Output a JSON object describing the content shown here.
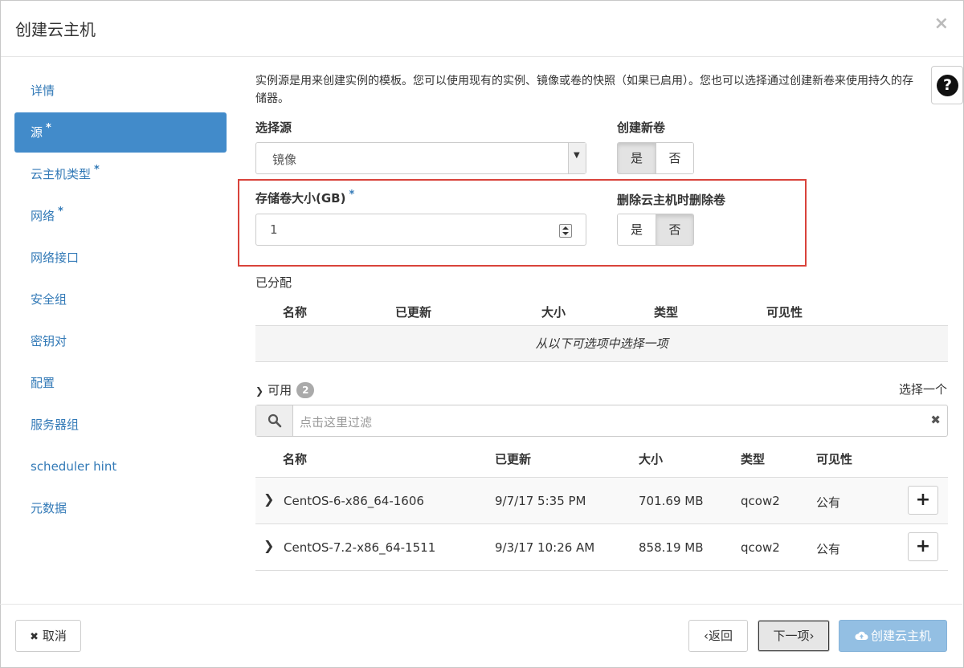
{
  "dialog": {
    "title": "创建云主机",
    "close_glyph": "×"
  },
  "nav": {
    "items": [
      {
        "label": "详情",
        "required": ""
      },
      {
        "label": "源",
        "required": "*"
      },
      {
        "label": "云主机类型",
        "required": "*"
      },
      {
        "label": "网络",
        "required": "*"
      },
      {
        "label": "网络接口",
        "required": ""
      },
      {
        "label": "安全组",
        "required": ""
      },
      {
        "label": "密钥对",
        "required": ""
      },
      {
        "label": "配置",
        "required": ""
      },
      {
        "label": "服务器组",
        "required": ""
      },
      {
        "label": "scheduler hint",
        "required": ""
      },
      {
        "label": "元数据",
        "required": ""
      }
    ],
    "active_index": 1
  },
  "source": {
    "intro": "实例源是用来创建实例的模板。您可以使用现有的实例、镜像或卷的快照（如果已启用）。您也可以选择通过创建新卷来使用持久的存储器。",
    "help_icon": "?",
    "select_source_label": "选择源",
    "select_source_value": "镜像",
    "create_volume_label": "创建新卷",
    "create_volume_yes": "是",
    "create_volume_no": "否",
    "create_volume_selected": "yes",
    "volume_size_label": "存储卷大小(GB)",
    "volume_size_required": "*",
    "volume_size_value": "1",
    "delete_on_terminate_label": "删除云主机时删除卷",
    "delete_yes": "是",
    "delete_no": "否",
    "delete_selected": "no"
  },
  "allocated": {
    "label": "已分配",
    "columns": [
      "名称",
      "已更新",
      "大小",
      "类型",
      "可见性"
    ],
    "empty_message": "从以下可选项中选择一项"
  },
  "available": {
    "label": "可用",
    "count": "2",
    "select_hint": "选择一个",
    "filter_placeholder": "点击这里过滤",
    "columns": [
      "名称",
      "已更新",
      "大小",
      "类型",
      "可见性"
    ],
    "rows": [
      {
        "name": "CentOS-6-x86_64-1606",
        "updated": "9/7/17 5:35 PM",
        "size": "701.69 MB",
        "type": "qcow2",
        "visibility": "公有"
      },
      {
        "name": "CentOS-7.2-x86_64-1511",
        "updated": "9/3/17 10:26 AM",
        "size": "858.19 MB",
        "type": "qcow2",
        "visibility": "公有"
      }
    ]
  },
  "footer": {
    "cancel_label": "取消",
    "back_label": "返回",
    "next_label": "下一项",
    "create_label": "创建云主机"
  },
  "colors": {
    "accent": "#428bca",
    "link": "#337ab7",
    "highlight_box": "#d9433b",
    "create_button_disabled": "#93bfe3"
  }
}
